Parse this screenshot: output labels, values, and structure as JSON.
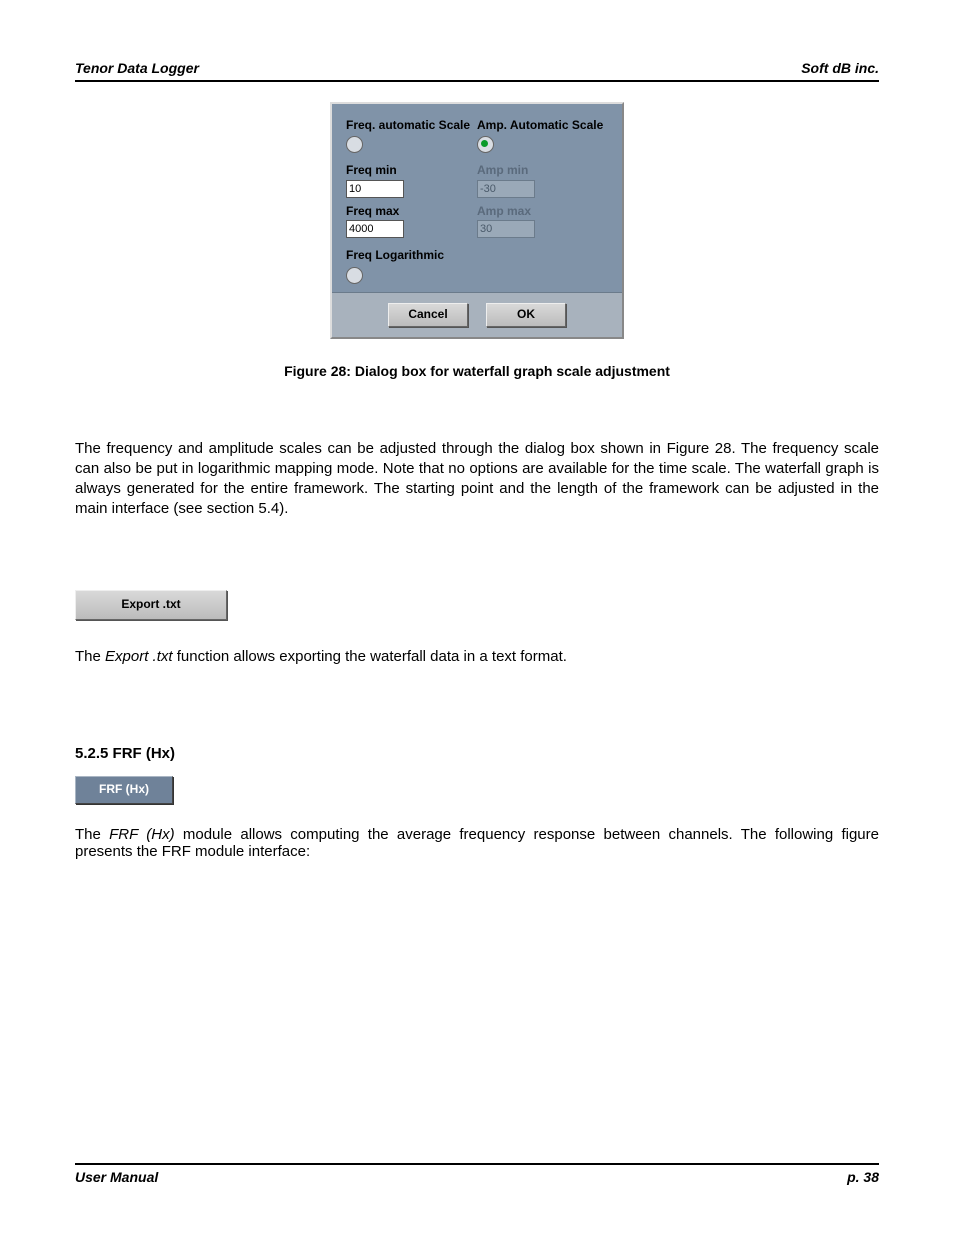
{
  "header": {
    "left": "Tenor Data Logger",
    "right": "Soft dB inc."
  },
  "dialog": {
    "freq_auto_label": "Freq. automatic Scale",
    "amp_auto_label": "Amp. Automatic Scale",
    "freq_auto_on": false,
    "amp_auto_on": true,
    "freq_min_label": "Freq min",
    "freq_min_value": "10",
    "freq_max_label": "Freq max",
    "freq_max_value": "4000",
    "amp_min_label": "Amp min",
    "amp_min_value": "-30",
    "amp_max_label": "Amp max",
    "amp_max_value": "30",
    "freq_log_label": "Freq Logarithmic",
    "freq_log_on": false,
    "cancel_label": "Cancel",
    "ok_label": "OK"
  },
  "figcaption": "Figure 28: Dialog box for waterfall graph scale adjustment",
  "para1": "The frequency and amplitude scales can be adjusted through the dialog box shown in Figure 28. The frequency scale can also be put in logarithmic mapping mode. Note that no options are available for the time scale. The waterfall graph is always generated for the entire framework. The starting point and the length of the framework can be adjusted in the main interface (see section 5.4).",
  "export_label": "Export .txt",
  "para2_pre": "The ",
  "para2_em": "Export .txt",
  "para2_post": " function allows exporting the waterfall data in a text format.",
  "section_heading": "5.2.5 FRF (Hx)",
  "frf_label": "FRF (Hx)",
  "para3_pre": "The ",
  "para3_em": "FRF (Hx)",
  "para3_post": " module allows computing the average frequency response between channels. The following figure presents the FRF module interface:",
  "footer": {
    "left": "User Manual",
    "right": "p. 38"
  }
}
